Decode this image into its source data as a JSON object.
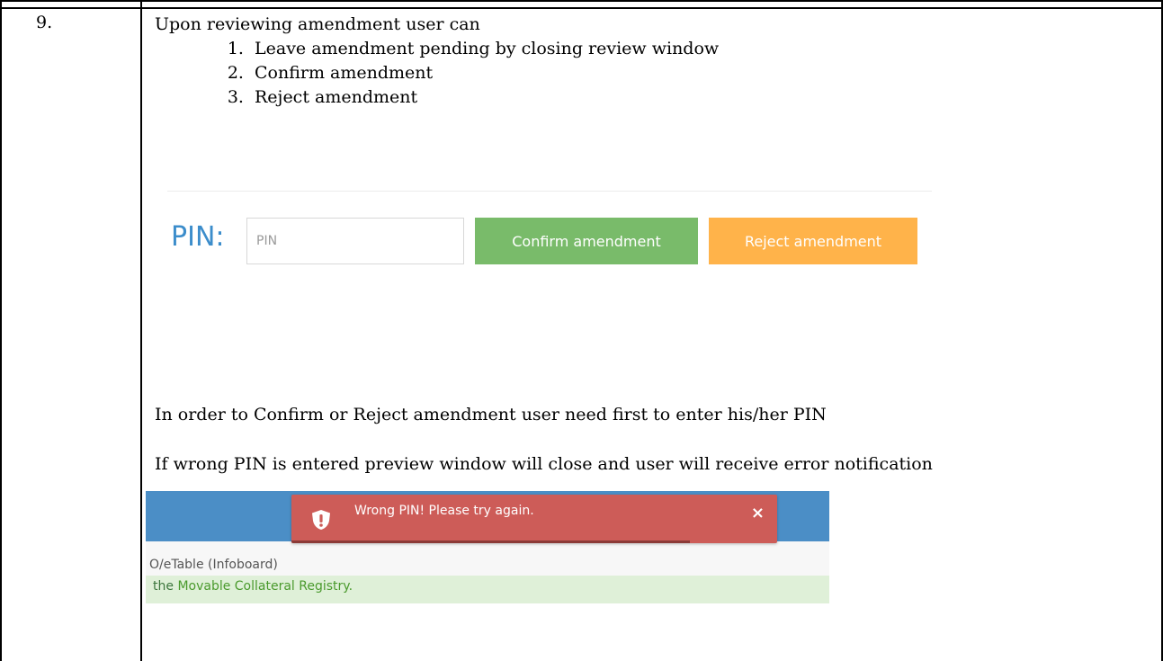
{
  "step": {
    "number": "9.",
    "intro": "Upon reviewing amendment user can",
    "options": [
      "Leave amendment pending by closing review window",
      "Confirm amendment",
      "Reject amendment"
    ]
  },
  "pin_form": {
    "label": "PIN:",
    "placeholder": "PIN",
    "confirm_label": "Confirm amendment",
    "reject_label": "Reject amendment",
    "colors": {
      "label": "#3c8dcb",
      "confirm": "#79bb6a",
      "reject": "#ffb34a"
    }
  },
  "notes": {
    "pin_required": "In order to Confirm or Reject amendment user need first to enter his/her PIN",
    "wrong_pin": "If wrong PIN is entered preview window will close and user will receive error notification"
  },
  "error_screenshot": {
    "sub_text": "O/eTable (Infoboard)",
    "registry_prefix": "the ",
    "registry_link": "Movable Collateral Registry.",
    "toast": {
      "icon": "shield-exclamation-icon",
      "message": "Wrong PIN! Please try again.",
      "close": "×",
      "progress": 0.82,
      "color": "#cd5c58"
    }
  }
}
